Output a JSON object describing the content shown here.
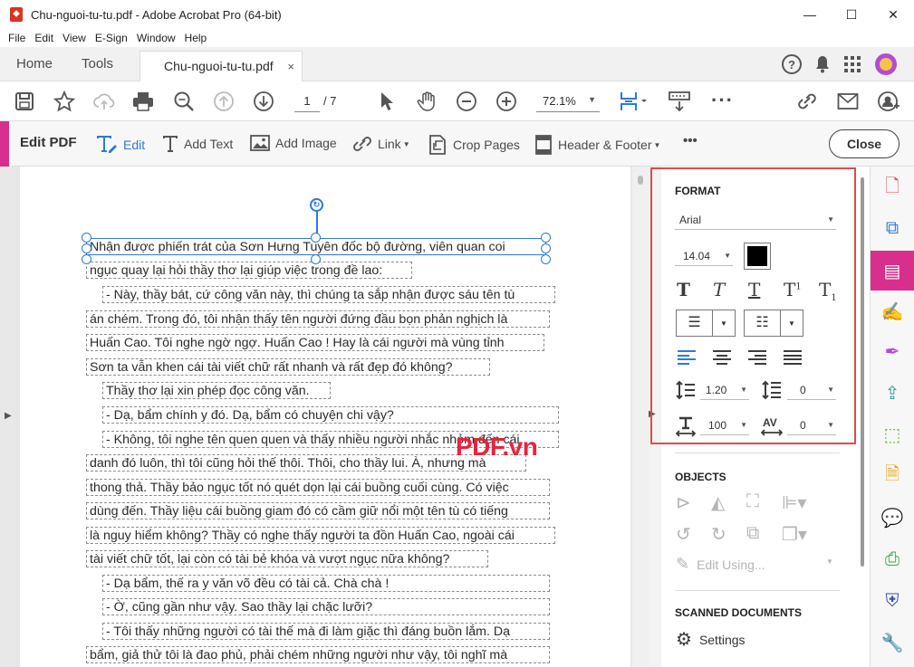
{
  "window": {
    "title": "Chu-nguoi-tu-tu.pdf - Adobe Acrobat Pro (64-bit)",
    "app_icon": "acrobat-icon",
    "min": "—",
    "max": "☐",
    "close": "✕"
  },
  "menu": [
    "File",
    "Edit",
    "View",
    "E-Sign",
    "Window",
    "Help"
  ],
  "tabs": {
    "home": "Home",
    "tools": "Tools",
    "doc": "Chu-nguoi-tu-tu.pdf",
    "doc_close": "×"
  },
  "toolbar": {
    "page_current": "1",
    "page_total": "/ 7",
    "zoom": "72.1%"
  },
  "edit_bar": {
    "title": "Edit PDF",
    "edit": "Edit",
    "add_text": "Add Text",
    "add_image": "Add Image",
    "link": "Link",
    "crop": "Crop Pages",
    "header_footer": "Header & Footer",
    "more": "•••",
    "close": "Close"
  },
  "document": {
    "lines": [
      "Nhận được phiến trát của Sơn Hưng Tuyên đốc bộ đường, viên quan coi",
      "ngục quay lại hỏi thầy thơ lại giúp việc trong đề lao:",
      "- Này, thầy bát, cứ công văn này, thì chúng ta sắp nhận được sáu tên tù",
      "án chém. Trong đó, tôi nhận thấy tên người đứng đầu bọn phản nghịch là",
      "Huấn Cao. Tôi nghe ngờ ngợ. Huấn Cao ! Hay là cái người mà vùng tỉnh",
      "Sơn ta vẫn khen cái tài viết chữ rất nhanh và rất đẹp đó không?",
      "Thầy thơ lại xin phép đọc công văn.",
      "- Dạ, bẩm chính y đó. Dạ, bẩm có chuyện chi vậy?",
      "- Không, tôi nghe tên quen quen và thấy nhiều người nhắc nhỏm đến cái",
      "danh đó luôn, thì tôi cũng hỏi thế thôi. Thôi, cho thầy lui. À, nhưng mà",
      "thong thả. Thầy bảo ngục tốt nó quét dọn lại cái buồng cuối cùng. Có việc",
      "dùng đến. Thầy liệu cái buồng giam đó có cầm giữ nổi một tên tù có tiếng",
      "là nguy hiểm không? Thầy có nghe thấy người ta đồn Huấn Cao, ngoài cái",
      "tài viết chữ tốt, lại còn có tài bẻ khóa và vượt ngục nữa không?",
      "- Dạ bẩm, thế ra y văn võ đều có tài cả. Chà chà !",
      "- Ờ, cũng gần như vậy. Sao thầy lại chặc lưỡi?",
      "- Tôi thấy những người có tài thế mà đi làm giặc thì đáng buồn lắm. Dạ",
      "bẩm, giả thử tôi là đao phủ, phải chém những người như vậy, tôi nghĩ mà"
    ],
    "watermark": "PDF.vn"
  },
  "panel": {
    "format_title": "FORMAT",
    "font": "Arial",
    "font_size": "14.04",
    "text_color": "#000000",
    "line_spacing": "1.20",
    "para_spacing": "0",
    "scale": "100",
    "char_spacing": "0",
    "objects_title": "OBJECTS",
    "edit_using": "Edit Using...",
    "scanned_title": "SCANNED DOCUMENTS",
    "settings": "Settings"
  },
  "colors": {
    "accent": "#d82e8c",
    "selection": "#2d7ad6",
    "highlight": "#e04a4a"
  }
}
